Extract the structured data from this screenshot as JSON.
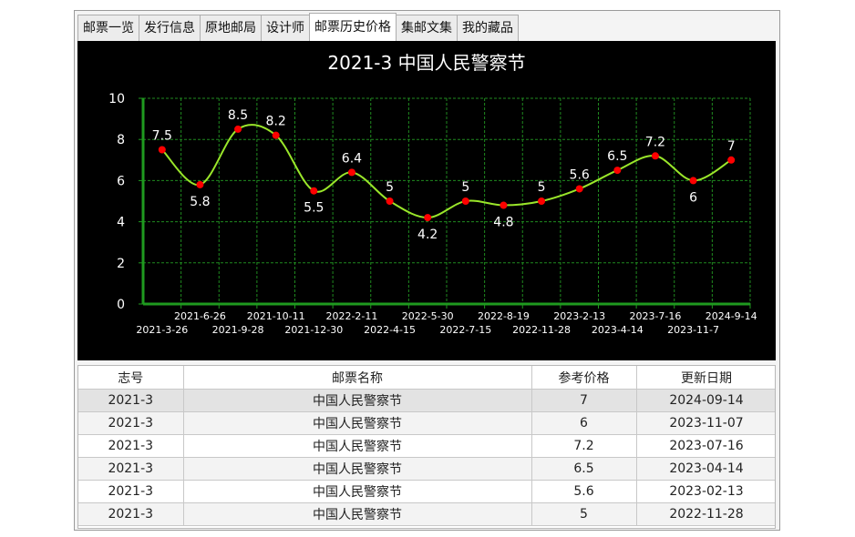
{
  "tabs": [
    {
      "label": "邮票一览"
    },
    {
      "label": "发行信息"
    },
    {
      "label": "原地邮局"
    },
    {
      "label": "设计师"
    },
    {
      "label": "邮票历史价格",
      "active": true
    },
    {
      "label": "集邮文集"
    },
    {
      "label": "我的藏品"
    }
  ],
  "colors": {
    "chart_background": "#000000",
    "line": "#9ae62a",
    "point": "#ff0000",
    "grid": "#1f8a1f",
    "axis": "#1f9a1f",
    "text": "#ffffff"
  },
  "chart_data": {
    "type": "line",
    "title": "2021-3 中国人民警察节",
    "x": [
      "2021-3-26",
      "2021-6-26",
      "2021-9-28",
      "2021-10-11",
      "2021-12-30",
      "2022-2-11",
      "2022-4-15",
      "2022-5-30",
      "2022-7-15",
      "2022-8-19",
      "2022-11-28",
      "2023-2-13",
      "2023-4-14",
      "2023-7-16",
      "2023-11-7",
      "2024-9-14"
    ],
    "values": [
      7.5,
      5.8,
      8.5,
      8.2,
      5.5,
      6.4,
      5,
      4.2,
      5,
      4.8,
      5,
      5.6,
      6.5,
      7.2,
      6,
      7
    ],
    "data_labels": [
      "7.5",
      "5.8",
      "8.5",
      "8.2",
      "5.5",
      "6.4",
      "5",
      "4.2",
      "5",
      "4.8",
      "5",
      "5.6",
      "6.5",
      "7.2",
      "6",
      "7"
    ],
    "ylim": [
      0,
      10
    ],
    "yticks": [
      "0",
      "2",
      "4",
      "6",
      "8",
      "10"
    ],
    "grid": true,
    "smooth": true
  },
  "table": {
    "columns": [
      "志号",
      "邮票名称",
      "参考价格",
      "更新日期"
    ],
    "rows": [
      [
        "2021-3",
        "中国人民警察节",
        "7",
        "2024-09-14"
      ],
      [
        "2021-3",
        "中国人民警察节",
        "6",
        "2023-11-07"
      ],
      [
        "2021-3",
        "中国人民警察节",
        "7.2",
        "2023-07-16"
      ],
      [
        "2021-3",
        "中国人民警察节",
        "6.5",
        "2023-04-14"
      ],
      [
        "2021-3",
        "中国人民警察节",
        "5.6",
        "2023-02-13"
      ],
      [
        "2021-3",
        "中国人民警察节",
        "5",
        "2022-11-28"
      ]
    ]
  }
}
